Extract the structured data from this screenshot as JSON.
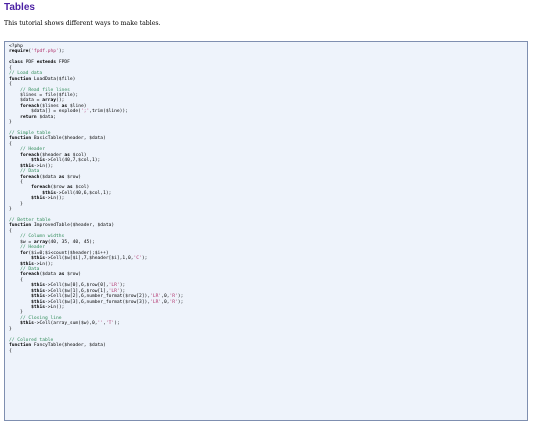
{
  "page": {
    "title": "Tables",
    "intro": "This tutorial shows different ways to make tables."
  },
  "code": {
    "lines": [
      "<?php",
      "require('fpdf.php');",
      "",
      "class PDF extends FPDF",
      "{",
      "// Load data",
      "function LoadData($file)",
      "{",
      "    // Read file lines",
      "    $lines = file($file);",
      "    $data = array();",
      "    foreach($lines as $line)",
      "        $data[] = explode(';',trim($line));",
      "    return $data;",
      "}",
      "",
      "// Simple table",
      "function BasicTable($header, $data)",
      "{",
      "    // Header",
      "    foreach($header as $col)",
      "        $this->Cell(40,7,$col,1);",
      "    $this->Ln();",
      "    // Data",
      "    foreach($data as $row)",
      "    {",
      "        foreach($row as $col)",
      "            $this->Cell(40,6,$col,1);",
      "        $this->Ln();",
      "    }",
      "}",
      "",
      "// Better table",
      "function ImprovedTable($header, $data)",
      "{",
      "    // Column widths",
      "    $w = array(40, 35, 40, 45);",
      "    // Header",
      "    for($i=0;$i<count($header);$i++)",
      "        $this->Cell($w[$i],7,$header[$i],1,0,'C');",
      "    $this->Ln();",
      "    // Data",
      "    foreach($data as $row)",
      "    {",
      "        $this->Cell($w[0],6,$row[0],'LR');",
      "        $this->Cell($w[1],6,$row[1],'LR');",
      "        $this->Cell($w[2],6,number_format($row[2]),'LR',0,'R');",
      "        $this->Cell($w[3],6,number_format($row[3]),'LR',0,'R');",
      "        $this->Ln();",
      "    }",
      "    // Closing line",
      "    $this->Cell(array_sum($w),0,'','T');",
      "}",
      "",
      "// Colored table",
      "function FancyTable($header, $data)",
      "{"
    ]
  }
}
